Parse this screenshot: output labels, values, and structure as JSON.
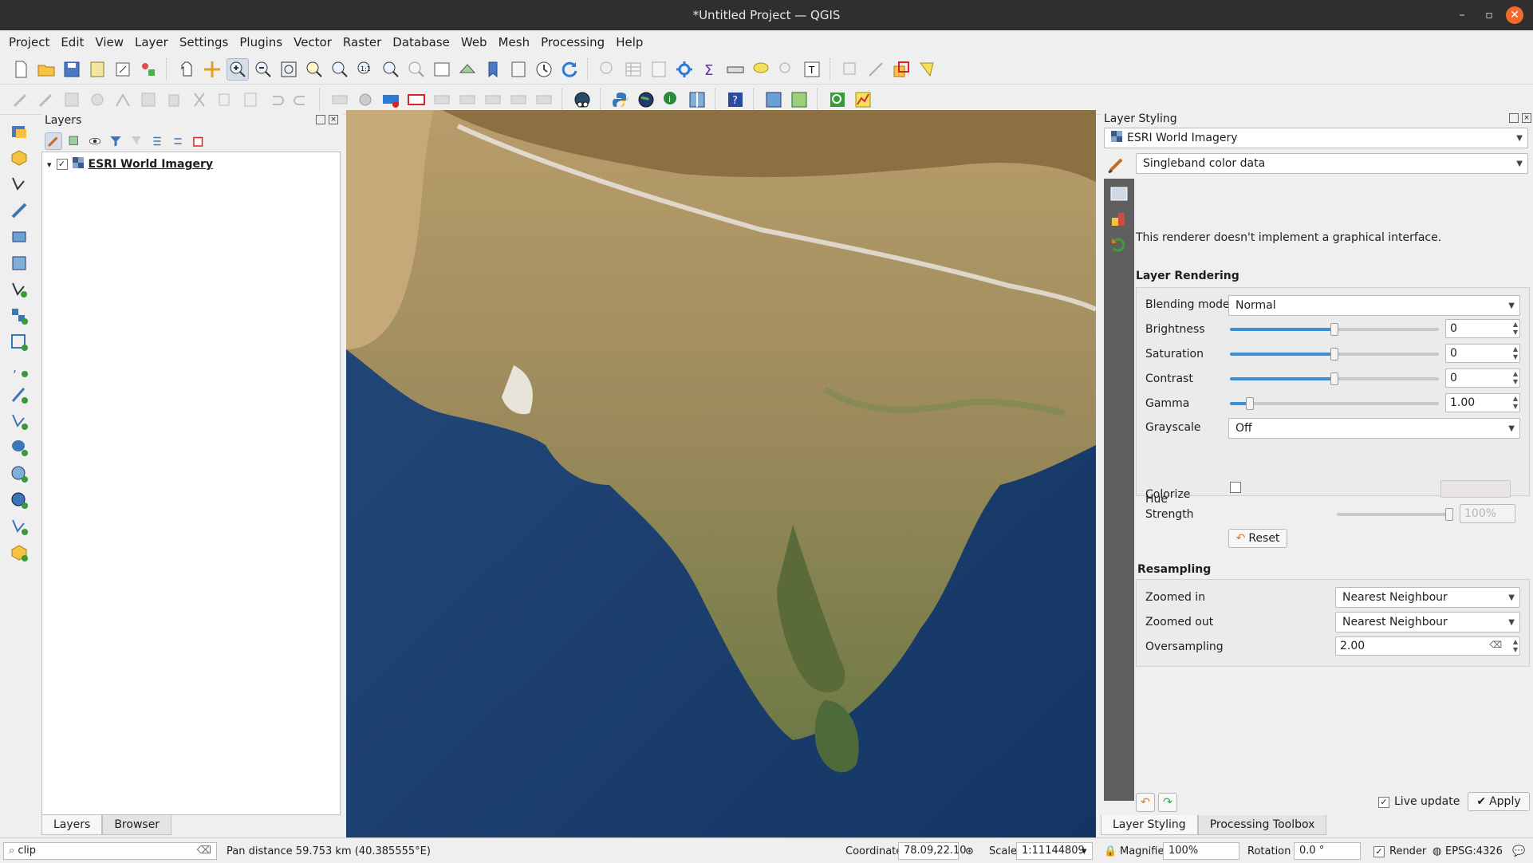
{
  "window": {
    "title": "*Untitled Project — QGIS",
    "minimize": "–",
    "maximize": "▫",
    "close": "✕"
  },
  "menubar": [
    "Project",
    "Edit",
    "View",
    "Layer",
    "Settings",
    "Plugins",
    "Vector",
    "Raster",
    "Database",
    "Web",
    "Mesh",
    "Processing",
    "Help"
  ],
  "layers_panel": {
    "title": "Layers",
    "layer": {
      "name": "ESRI World Imagery",
      "checked": "✓",
      "expander": "▾"
    },
    "tabs": [
      "Layers",
      "Browser"
    ]
  },
  "styling_panel": {
    "title": "Layer Styling",
    "layer_select": "ESRI World Imagery",
    "renderer_select": "Singleband color data",
    "message": "This renderer doesn't implement a graphical interface.",
    "layer_rendering": {
      "title": "Layer Rendering",
      "blending_label": "Blending mode",
      "blending_value": "Normal",
      "brightness_label": "Brightness",
      "brightness_value": "0",
      "saturation_label": "Saturation",
      "saturation_value": "0",
      "contrast_label": "Contrast",
      "contrast_value": "0",
      "gamma_label": "Gamma",
      "gamma_value": "1.00",
      "grayscale_label": "Grayscale",
      "grayscale_value": "Off",
      "hue_label": "Hue",
      "colorize_label": "Colorize",
      "strength_label": "Strength",
      "strength_value": "100%",
      "reset_label": "Reset"
    },
    "resampling": {
      "title": "Resampling",
      "zoomed_in_label": "Zoomed in",
      "zoomed_in_value": "Nearest Neighbour",
      "zoomed_out_label": "Zoomed out",
      "zoomed_out_value": "Nearest Neighbour",
      "oversampling_label": "Oversampling",
      "oversampling_value": "2.00"
    },
    "live_update_label": "Live update",
    "live_update_checked": "✓",
    "apply_label": "Apply",
    "tabs": [
      "Layer Styling",
      "Processing Toolbox"
    ]
  },
  "statusbar": {
    "search_value": "clip",
    "message": "Pan distance 59.753 km (40.385555°E)",
    "coordinate_label": "Coordinate",
    "coordinate_value": "78.09,22.10",
    "scale_label": "Scale",
    "scale_value": "1:11144809",
    "magnifier_label": "Magnifier",
    "magnifier_value": "100%",
    "rotation_label": "Rotation",
    "rotation_value": "0.0 °",
    "render_label": "Render",
    "render_checked": "✓",
    "crs": "EPSG:4326"
  },
  "colors": {
    "accent": "#3d8fd6",
    "titlebar": "#2f2f2f",
    "close": "#f26b2b",
    "ocean": "#1c3f6b",
    "land": "#a88d5f"
  }
}
